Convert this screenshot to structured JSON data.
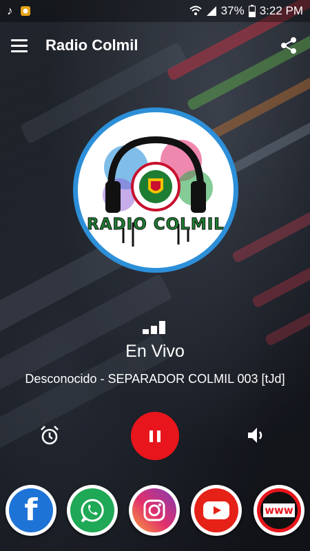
{
  "status_bar": {
    "battery": "37%",
    "time": "3:22 PM"
  },
  "app_bar": {
    "title": "Radio Colmil"
  },
  "logo": {
    "text": "RADIO COLMIL"
  },
  "player": {
    "status": "En Vivo",
    "now_playing": "Desconocido - SEPARADOR COLMIL 003 [tJd]"
  },
  "social": {
    "facebook_label": "f",
    "web_label": "www"
  },
  "colors": {
    "accent_blue": "#2d8fd8",
    "pause_red": "#e8161c",
    "facebook": "#1e73d6",
    "whatsapp": "#1fa855",
    "instagram": "#c13584",
    "youtube": "#e62117"
  }
}
